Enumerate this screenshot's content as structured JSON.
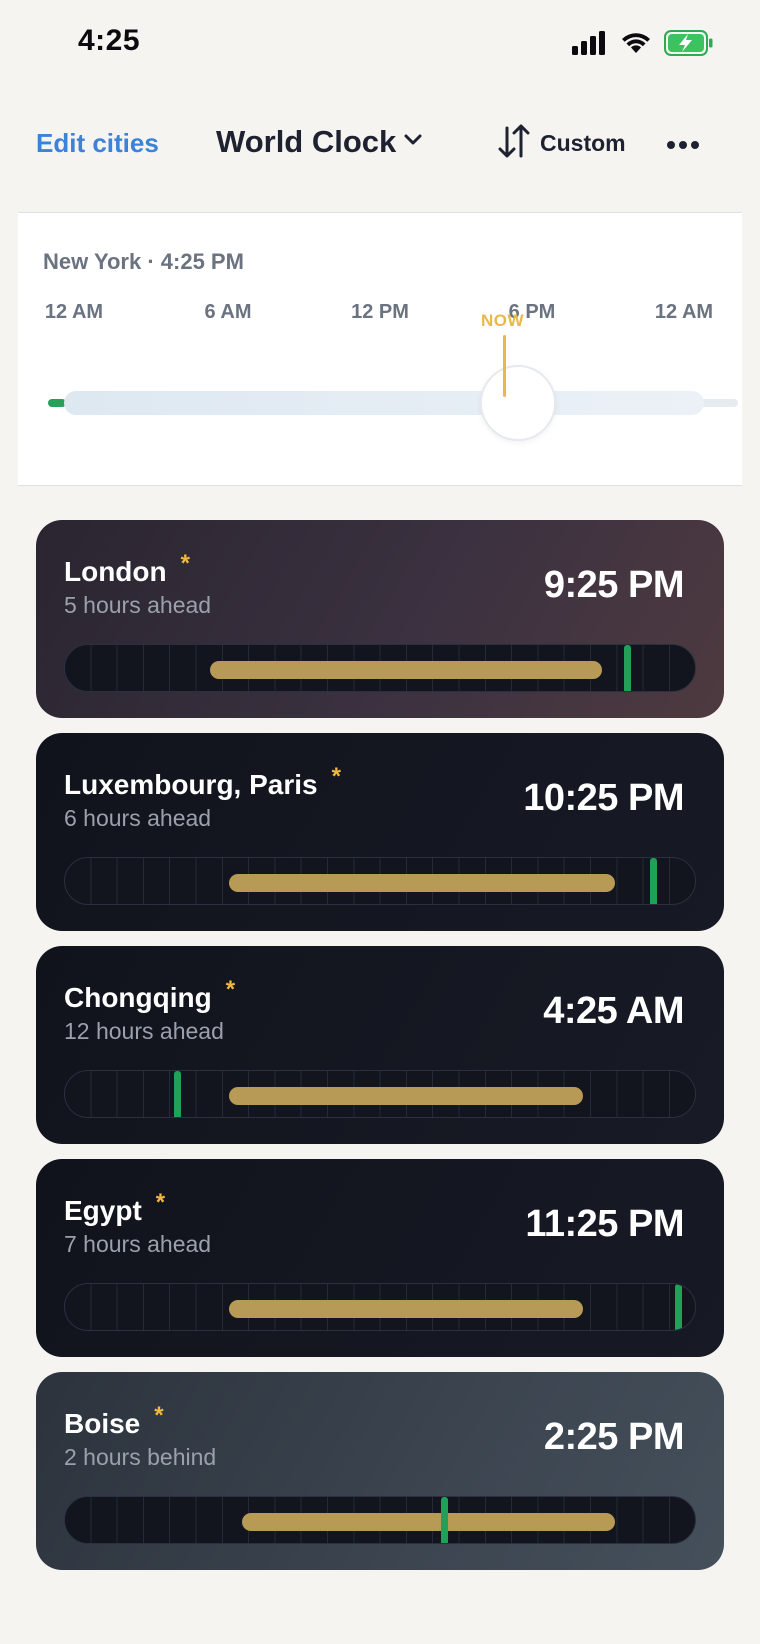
{
  "status_bar": {
    "time": "4:25"
  },
  "header": {
    "edit_label": "Edit cities",
    "title": "World Clock",
    "sort_label": "Custom"
  },
  "reference": {
    "title": "New York · 4:25 PM",
    "ticks": [
      "12 AM",
      "6 AM",
      "12 PM",
      "6 PM",
      "12 AM"
    ],
    "now_label": "NOW",
    "now_fraction": 0.684
  },
  "cities": [
    {
      "name": "London",
      "offset": "5 hours ahead",
      "time": "9:25 PM",
      "bar_start": 0.23,
      "bar_end": 0.85,
      "now": 0.889,
      "bg": "linear-gradient(120deg,#2a2530 0%,#3b3140 55%,#4e3a40 100%)"
    },
    {
      "name": "Luxembourg, Paris",
      "offset": "6 hours ahead",
      "time": "10:25 PM",
      "bar_start": 0.26,
      "bar_end": 0.87,
      "now": 0.93,
      "bg": "linear-gradient(120deg,#11131c 0%,#171925 100%)"
    },
    {
      "name": "Chongqing",
      "offset": "12 hours ahead",
      "time": "4:25 AM",
      "bar_start": 0.26,
      "bar_end": 0.82,
      "now": 0.178,
      "bg": "linear-gradient(120deg,#11131c 0%,#181b26 100%)"
    },
    {
      "name": "Egypt",
      "offset": "7 hours ahead",
      "time": "11:25 PM",
      "bar_start": 0.26,
      "bar_end": 0.82,
      "now": 0.97,
      "bg": "linear-gradient(120deg,#11131c 0%,#171925 100%)"
    },
    {
      "name": "Boise",
      "offset": "2 hours behind",
      "time": "2:25 PM",
      "bar_start": 0.28,
      "bar_end": 0.87,
      "now": 0.6,
      "bg": "linear-gradient(120deg,#2c333d 0%,#3c4550 60%,#45505b 100%)"
    }
  ],
  "colors": {
    "accent": "#3b82d8",
    "now": "#e9b84a",
    "bar": "#b79a55",
    "current": "#21a057"
  }
}
